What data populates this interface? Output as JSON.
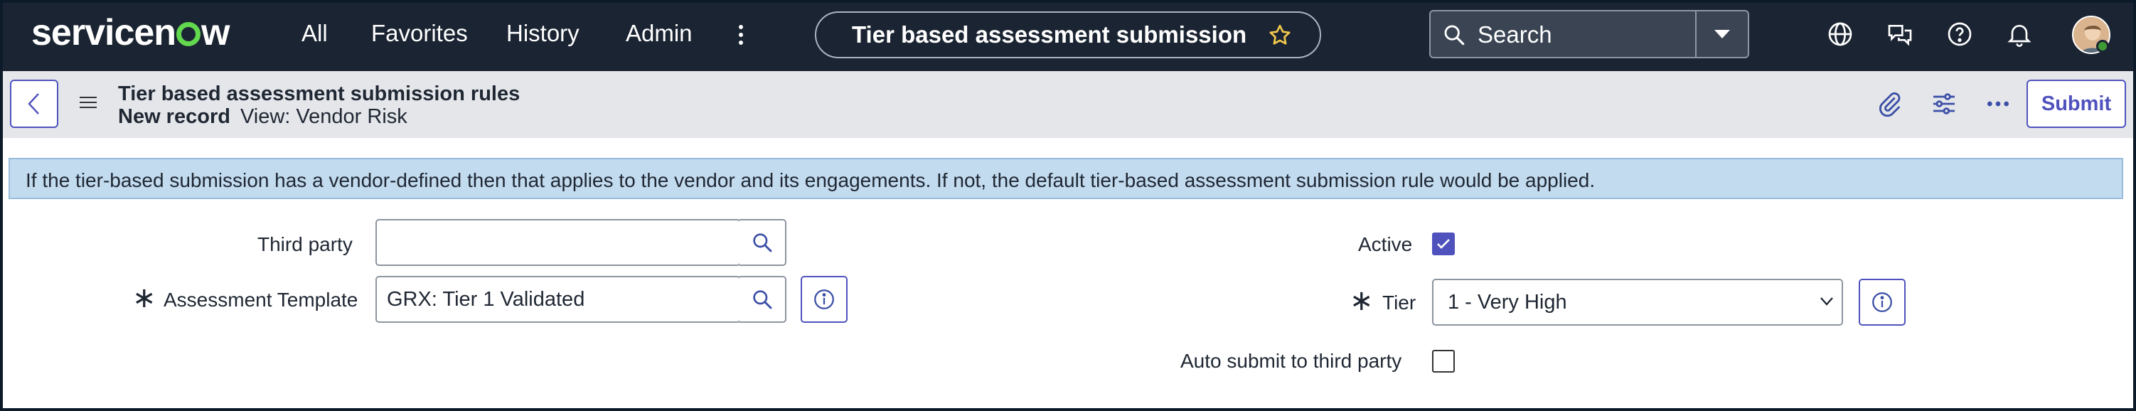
{
  "nav": {
    "logo": "servicenow",
    "items": [
      "All",
      "Favorites",
      "History",
      "Admin"
    ],
    "more_icon": "more-vertical-icon",
    "record_title": "Tier based assessment submission r…",
    "search_placeholder": "Search"
  },
  "header": {
    "title": "Tier based assessment submission rules",
    "record_state": "New record",
    "view": "View: Vendor Risk",
    "submit_label": "Submit"
  },
  "banner": {
    "text": "If the tier-based submission has a vendor-defined then that applies to the vendor and its engagements. If not, the default tier-based assessment submission rule would be applied."
  },
  "form": {
    "third_party": {
      "label": "Third party",
      "value": ""
    },
    "assessment_template": {
      "label": "Assessment Template",
      "value": "GRX: Tier 1 Validated",
      "required_mark": "∗"
    },
    "active": {
      "label": "Active",
      "checked": true
    },
    "tier": {
      "label": "Tier",
      "value": "1 - Very High",
      "required_mark": "∗"
    },
    "auto_submit": {
      "label": "Auto submit to third party",
      "checked": false
    }
  },
  "colors": {
    "nav_bg": "#1b2432",
    "accent": "#4f52bd",
    "logo_green": "#62d84e",
    "banner_bg": "#c3dbef",
    "header_bg": "#e4e6ea"
  }
}
